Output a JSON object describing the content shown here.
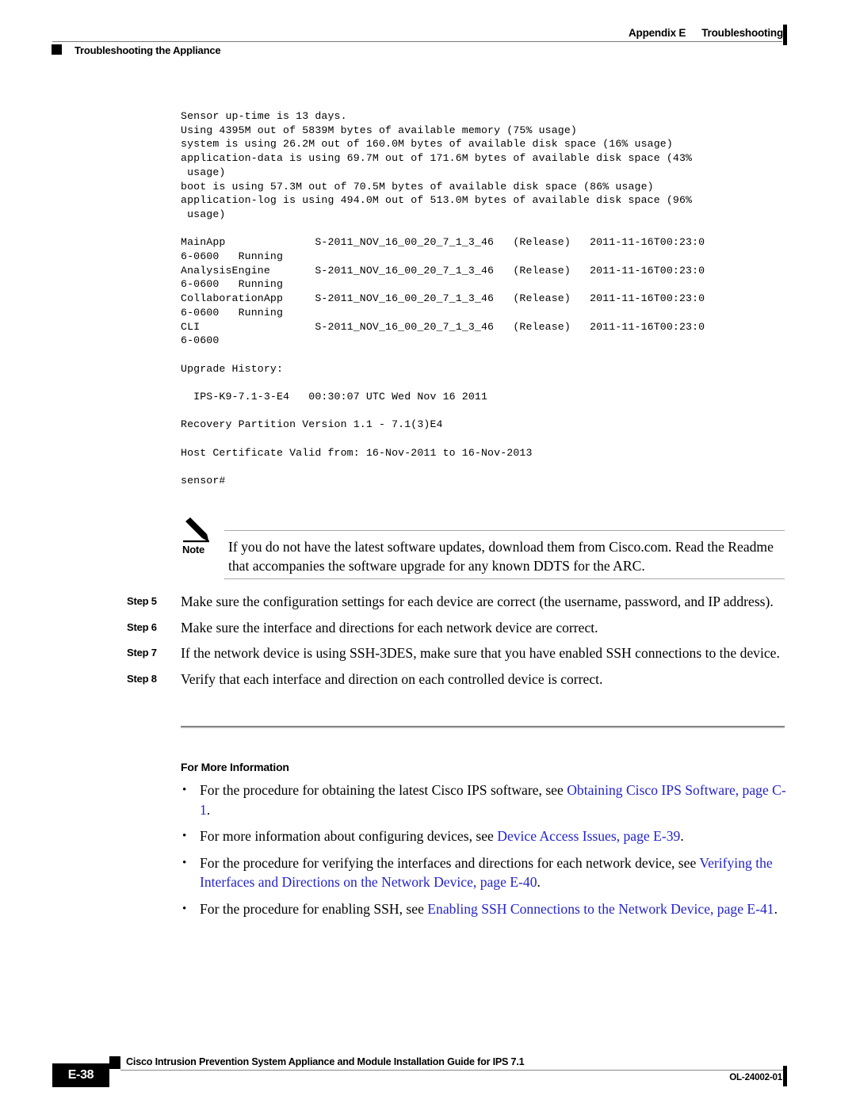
{
  "header": {
    "appendix_label": "Appendix E",
    "appendix_title": "Troubleshooting",
    "section_title": "Troubleshooting the Appliance"
  },
  "console_output": {
    "lines": [
      "Sensor up-time is 13 days.",
      "Using 4395M out of 5839M bytes of available memory (75% usage)",
      "system is using 26.2M out of 160.0M bytes of available disk space (16% usage)",
      "application-data is using 69.7M out of 171.6M bytes of available disk space (43%",
      " usage)",
      "boot is using 57.3M out of 70.5M bytes of available disk space (86% usage)",
      "application-log is using 494.0M out of 513.0M bytes of available disk space (96%",
      " usage)",
      "",
      "MainApp              S-2011_NOV_16_00_20_7_1_3_46   (Release)   2011-11-16T00:23:0",
      "6-0600   Running",
      "AnalysisEngine       S-2011_NOV_16_00_20_7_1_3_46   (Release)   2011-11-16T00:23:0",
      "6-0600   Running",
      "CollaborationApp     S-2011_NOV_16_00_20_7_1_3_46   (Release)   2011-11-16T00:23:0",
      "6-0600   Running",
      "CLI                  S-2011_NOV_16_00_20_7_1_3_46   (Release)   2011-11-16T00:23:0",
      "6-0600",
      "",
      "Upgrade History:",
      "",
      "  IPS-K9-7.1-3-E4   00:30:07 UTC Wed Nov 16 2011",
      "",
      "Recovery Partition Version 1.1 - 7.1(3)E4",
      "",
      "Host Certificate Valid from: 16-Nov-2011 to 16-Nov-2013",
      "",
      "sensor#"
    ]
  },
  "note": {
    "label": "Note",
    "text": "If you do not have the latest software updates, download them from Cisco.com. Read the Readme that accompanies the software upgrade for any known DDTS for the ARC."
  },
  "steps": [
    {
      "label": "Step 5",
      "text": "Make sure the configuration settings for each device are correct (the username, password, and IP address)."
    },
    {
      "label": "Step 6",
      "text": "Make sure the interface and directions for each network device are correct."
    },
    {
      "label": "Step 7",
      "text": "If the network device is using SSH-3DES, make sure that you have enabled SSH connections to the device."
    },
    {
      "label": "Step 8",
      "text": "Verify that each interface and direction on each controlled device is correct."
    }
  ],
  "for_more_information": {
    "heading": "For More Information",
    "bullet_mark": "•",
    "items": [
      {
        "lead": "For the procedure for obtaining the latest Cisco IPS software, see ",
        "link": "Obtaining Cisco IPS Software, page C-1",
        "tail": "."
      },
      {
        "lead": "For more information about configuring devices, see ",
        "link": "Device Access Issues, page E-39",
        "tail": "."
      },
      {
        "lead": "For the procedure for verifying the interfaces and directions for each network device, see ",
        "link": "Verifying the Interfaces and Directions on the Network Device, page E-40",
        "tail": "."
      },
      {
        "lead": "For the procedure for enabling SSH, see ",
        "link": "Enabling SSH Connections to the Network Device, page E-41",
        "tail": "."
      }
    ]
  },
  "footer": {
    "page_number": "E-38",
    "book_title": "Cisco Intrusion Prevention System Appliance and Module Installation Guide for IPS 7.1",
    "doc_id": "OL-24002-01"
  },
  "colors": {
    "link": "#2323CC",
    "rule": "#9B9B9B",
    "ink": "#000000"
  }
}
